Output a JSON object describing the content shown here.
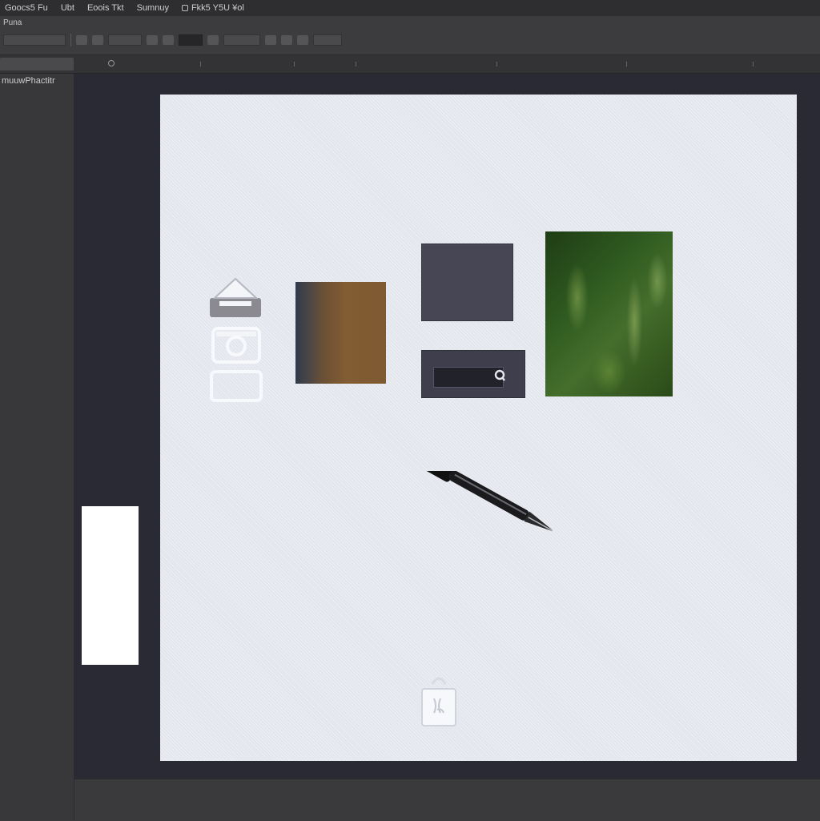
{
  "menubar": {
    "items": [
      "Goocs5 Fu",
      "Ubt",
      "Eoois Tkt",
      "Sumnuy",
      "Fkk5 Y5U ¥ol"
    ]
  },
  "options_bar": {
    "tool_label": "Puna"
  },
  "left_panel": {
    "title": "muuwPhactitr"
  },
  "canvas": {
    "search": {
      "value": "",
      "placeholder": ""
    }
  },
  "colors": {
    "artboard": "#e4e6ee",
    "workspace": "#2a2a35",
    "chrome": "#3a3a3c",
    "pen_tip": "#5b78d0"
  },
  "icons": {
    "eject": "eject-icon",
    "camera": "camera-icon",
    "frame": "frame-icon",
    "search": "search-icon",
    "pen": "pen-icon",
    "bag": "bag-icon",
    "close": "close-icon"
  }
}
